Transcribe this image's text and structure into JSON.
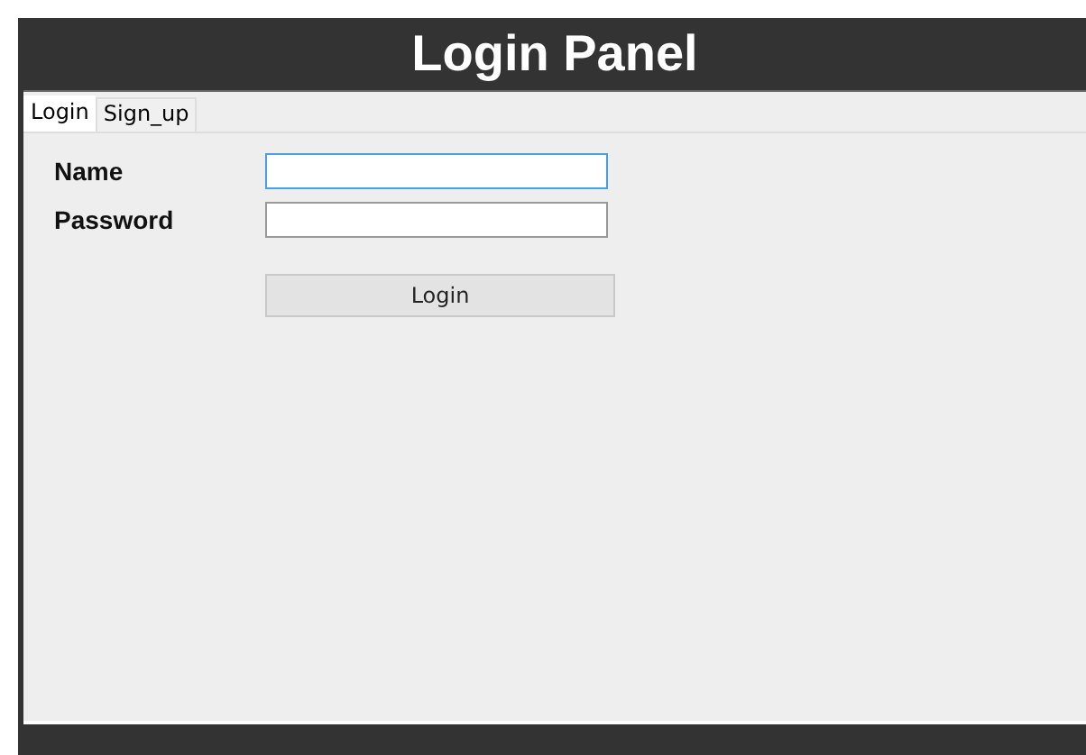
{
  "header": {
    "title": "Login Panel"
  },
  "tabs": [
    {
      "label": "Login",
      "selected": true
    },
    {
      "label": "Sign_up",
      "selected": false
    }
  ],
  "fields": [
    {
      "label": "Name",
      "focused": true
    },
    {
      "label": "Password",
      "focused": false
    }
  ],
  "button": {
    "label": "Login"
  }
}
